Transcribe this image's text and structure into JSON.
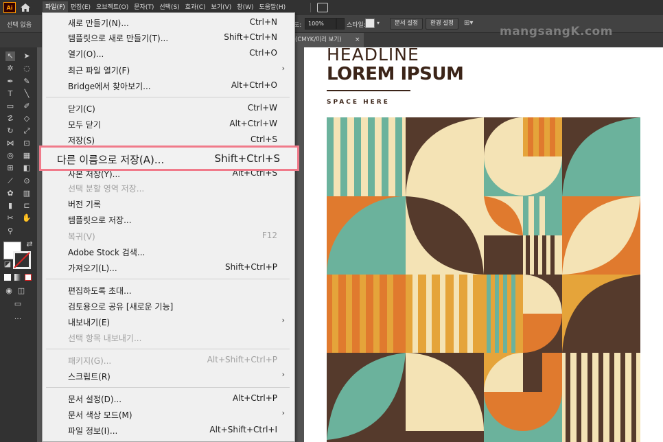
{
  "app": {
    "logo_text": "Ai",
    "menus": [
      "파일(F)",
      "편집(E)",
      "오브젝트(O)",
      "문자(T)",
      "선택(S)",
      "효과(C)",
      "보기(V)",
      "창(W)",
      "도움말(H)"
    ]
  },
  "control_bar": {
    "selection_label": "선택 없음",
    "zoom_label": "도:",
    "zoom_value": "100%",
    "style_label": "스타일:",
    "document_setup": "문서 설정",
    "preferences": "환경 설정"
  },
  "document_tab": {
    "title": "(CMYK/미리 보기)",
    "close": "×"
  },
  "watermark": "mangsangK.com",
  "file_menu": {
    "items": [
      {
        "label": "새로 만들기(N)...",
        "shortcut": "Ctrl+N",
        "disabled": false,
        "submenu": false
      },
      {
        "label": "템플릿으로 새로 만들기(T)...",
        "shortcut": "Shift+Ctrl+N",
        "disabled": false,
        "submenu": false
      },
      {
        "label": "열기(O)...",
        "shortcut": "Ctrl+O",
        "disabled": false,
        "submenu": false
      },
      {
        "label": "최근 파일 열기(F)",
        "shortcut": "",
        "disabled": false,
        "submenu": true
      },
      {
        "label": "Bridge에서 찾아보기...",
        "shortcut": "Alt+Ctrl+O",
        "disabled": false,
        "submenu": false
      },
      {
        "label": "닫기(C)",
        "shortcut": "Ctrl+W",
        "disabled": false,
        "submenu": false
      },
      {
        "label": "모두 닫기",
        "shortcut": "Alt+Ctrl+W",
        "disabled": false,
        "submenu": false
      },
      {
        "label": "저장(S)",
        "shortcut": "Ctrl+S",
        "disabled": false,
        "submenu": false
      },
      {
        "label": "사본 저장(Y)...",
        "shortcut": "Alt+Ctrl+S",
        "disabled": false,
        "submenu": false
      },
      {
        "label": "선택 분할 영역 저장...",
        "shortcut": "",
        "disabled": true,
        "submenu": false
      },
      {
        "label": "버전 기록",
        "shortcut": "",
        "disabled": false,
        "submenu": false
      },
      {
        "label": "템플릿으로 저장...",
        "shortcut": "",
        "disabled": false,
        "submenu": false
      },
      {
        "label": "복귀(V)",
        "shortcut": "F12",
        "disabled": true,
        "submenu": false
      },
      {
        "label": "Adobe Stock 검색...",
        "shortcut": "",
        "disabled": false,
        "submenu": false
      },
      {
        "label": "가져오기(L)...",
        "shortcut": "Shift+Ctrl+P",
        "disabled": false,
        "submenu": false
      },
      {
        "label": "편집하도록 초대...",
        "shortcut": "",
        "disabled": false,
        "submenu": false
      },
      {
        "label": "검토용으로 공유 [새로운 기능]",
        "shortcut": "",
        "disabled": false,
        "submenu": false
      },
      {
        "label": "내보내기(E)",
        "shortcut": "",
        "disabled": false,
        "submenu": true
      },
      {
        "label": "선택 항목 내보내기...",
        "shortcut": "",
        "disabled": true,
        "submenu": false
      },
      {
        "label": "패키지(G)...",
        "shortcut": "Alt+Shift+Ctrl+P",
        "disabled": true,
        "submenu": false
      },
      {
        "label": "스크립트(R)",
        "shortcut": "",
        "disabled": false,
        "submenu": true
      },
      {
        "label": "문서 설정(D)...",
        "shortcut": "Alt+Ctrl+P",
        "disabled": false,
        "submenu": false
      },
      {
        "label": "문서 색상 모드(M)",
        "shortcut": "",
        "disabled": false,
        "submenu": true
      },
      {
        "label": "파일 정보(I)...",
        "shortcut": "Alt+Shift+Ctrl+I",
        "disabled": false,
        "submenu": false
      }
    ],
    "highlighted": {
      "label": "다른 이름으로 저장(A)...",
      "shortcut": "Shift+Ctrl+S"
    }
  },
  "artboard": {
    "headline": "HEADLINE",
    "title": "LOREM IPSUM",
    "subtitle": "SPACE HERE"
  },
  "colors": {
    "teal": "#6bb29c",
    "orange": "#e07a2e",
    "brown": "#553a2c",
    "cream": "#f4e3b5",
    "mustard": "#e5a43a",
    "highlight_border": "#f07a8a"
  }
}
